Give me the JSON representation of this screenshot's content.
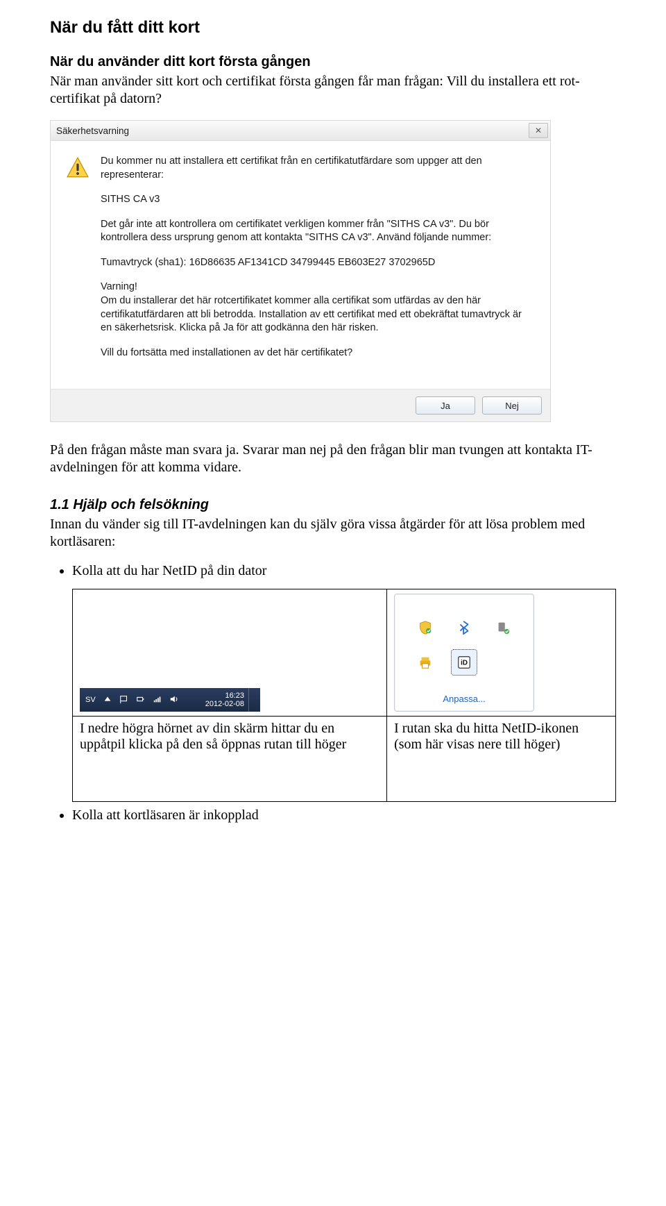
{
  "headings": {
    "main": "När du fått ditt kort",
    "sub": "När du använder ditt kort första gången",
    "section": "1.1   Hjälp och felsökning"
  },
  "intro": {
    "p1": "När man använder sitt kort och certifikat första gången får man frågan: Vill du installera ett rot-certifikat på datorn?",
    "p2": "På den frågan måste man svara ja. Svarar man nej på den frågan blir man tvungen att kontakta IT-avdelningen för att komma vidare.",
    "p3": "Innan du vänder sig till IT-avdelningen kan du själv göra vissa åtgärder för att lösa problem med kortläsaren:"
  },
  "bullets": {
    "b1": "Kolla att du har NetID på din dator",
    "b2": "Kolla att kortläsaren är inkopplad"
  },
  "dialog": {
    "title": "Säkerhetsvarning",
    "p1": "Du kommer nu att installera ett certifikat från en certifikatutfärdare som uppger att den representerar:",
    "p2": "SITHS CA v3",
    "p3": "Det går inte att kontrollera om certifikatet verkligen kommer från \"SITHS CA v3\". Du bör kontrollera dess ursprung genom att kontakta \"SITHS CA v3\". Använd följande nummer:",
    "p4": "Tumavtryck (sha1): 16D86635 AF1341CD 34799445 EB603E27 3702965D",
    "p5a": "Varning!",
    "p5b": "Om du installerar det här rotcertifikatet kommer alla certifikat som utfärdas av den här certifikatutfärdaren att bli betrodda. Installation av ett certifikat med ett obekräftat tumavtryck är en säkerhetsrisk. Klicka på Ja för att godkänna den här risken.",
    "p6": "Vill du fortsätta med installationen av det här certifikatet?",
    "yes": "Ja",
    "no": "Nej"
  },
  "taskbar": {
    "lang": "SV",
    "time": "16:23",
    "date": "2012-02-08"
  },
  "tray": {
    "customize": "Anpassa...",
    "netid": "iD"
  },
  "captions": {
    "left": "I nedre högra hörnet av din skärm hittar du en uppåtpil klicka på den så öppnas rutan till höger",
    "right": "I rutan ska du hitta NetID-ikonen (som här visas nere till höger)"
  }
}
